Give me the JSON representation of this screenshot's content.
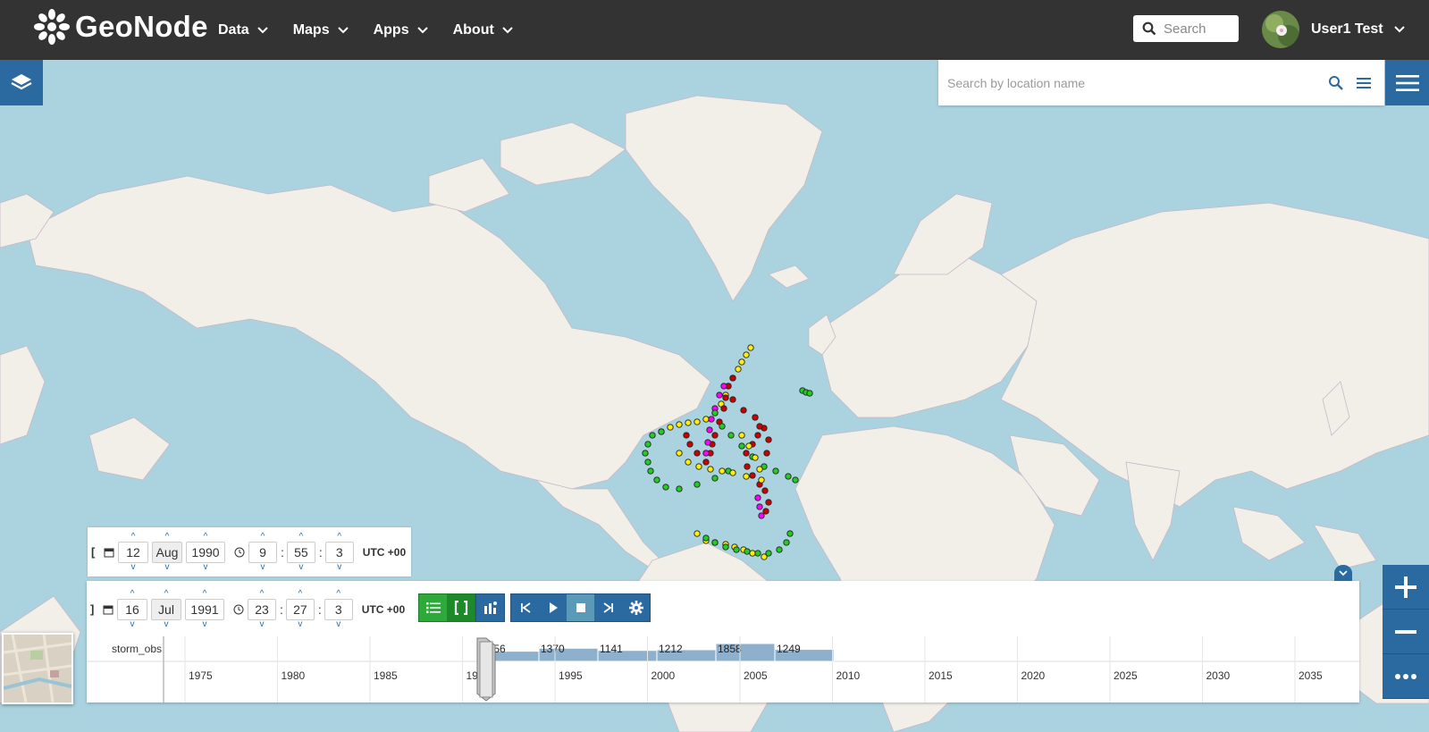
{
  "header": {
    "logo_text": "GeoNode",
    "nav": [
      {
        "label": "Data"
      },
      {
        "label": "Maps"
      },
      {
        "label": "Apps"
      },
      {
        "label": "About"
      }
    ],
    "search_placeholder": "Search",
    "user_name": "User1 Test"
  },
  "map": {
    "location_search_placeholder": "Search by location name",
    "colors": {
      "water": "#aad3df",
      "land": "#f2efe9",
      "accent": "#2b6aa0",
      "storm_points": [
        "#ffee00",
        "#22cc22",
        "#cc0000",
        "#ff00ff"
      ]
    }
  },
  "time": {
    "start": {
      "day": "12",
      "month": "Aug",
      "year": "1990",
      "hour": "9",
      "minute": "55",
      "second": "3",
      "bracket": "[",
      "utc": "UTC +00"
    },
    "end": {
      "day": "16",
      "month": "Jul",
      "year": "1991",
      "hour": "23",
      "minute": "27",
      "second": "3",
      "bracket": "]",
      "utc": "UTC +00"
    }
  },
  "timeline": {
    "layer_label": "storm_obs",
    "years": [
      "1975",
      "1980",
      "1985",
      "1990",
      "1995",
      "2000",
      "2005",
      "2010",
      "2015",
      "2020",
      "2025",
      "2030",
      "2035"
    ],
    "histogram": [
      {
        "label": "1056",
        "value": 1056
      },
      {
        "label": "1370",
        "value": 1370
      },
      {
        "label": "1141",
        "value": 1141
      },
      {
        "label": "1212",
        "value": 1212
      },
      {
        "label": "1858",
        "value": 1858
      },
      {
        "label": "1249",
        "value": 1249
      }
    ]
  }
}
